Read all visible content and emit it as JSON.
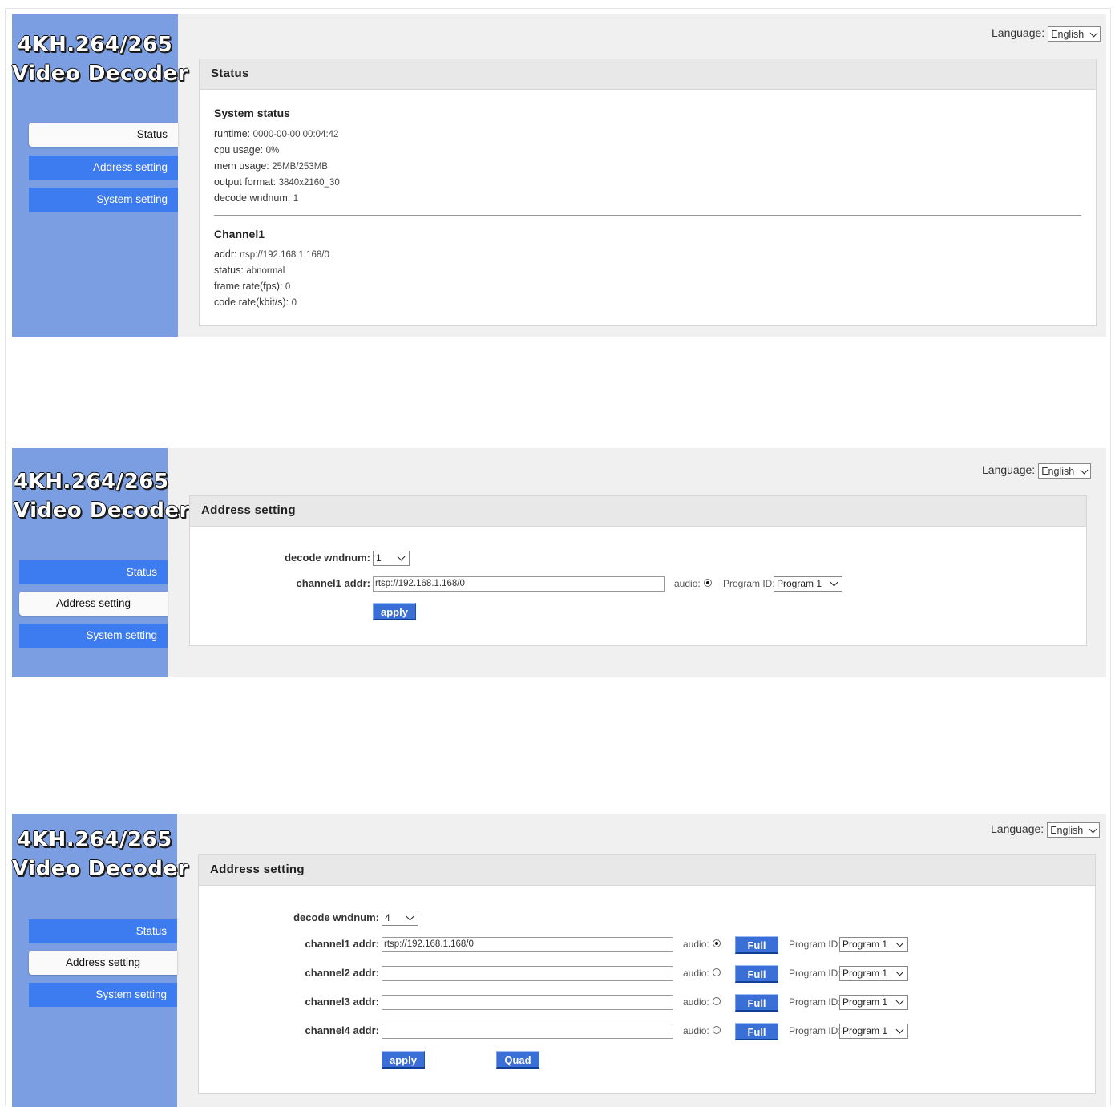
{
  "app": {
    "logo_line1": "4KH.264/265",
    "logo_line2": "Video Decoder"
  },
  "nav": {
    "status": "Status",
    "address": "Address setting",
    "system": "System setting"
  },
  "language": {
    "label": "Language:",
    "value": "English"
  },
  "colors": {
    "sidebar": "#7b9ee2",
    "nav_inactive": "#3d7bf0",
    "panel_bg": "#f0f0f0",
    "button": "#3a6fd8"
  },
  "panel1": {
    "card_title": "Status",
    "system_status": {
      "heading": "System status",
      "rows": [
        {
          "label": "runtime:",
          "value": "0000-00-00 00:04:42"
        },
        {
          "label": "cpu usage:",
          "value": "0%"
        },
        {
          "label": "mem usage:",
          "value": "25MB/253MB"
        },
        {
          "label": "output format:",
          "value": "3840x2160_30"
        },
        {
          "label": "decode wndnum:",
          "value": "1"
        }
      ]
    },
    "channel1": {
      "heading": "Channel1",
      "rows": [
        {
          "label": "addr:",
          "value": "rtsp://192.168.1.168/0"
        },
        {
          "label": "status:",
          "value": "abnormal"
        },
        {
          "label": "frame rate(fps):",
          "value": "0"
        },
        {
          "label": "code rate(kbit/s):",
          "value": "0"
        }
      ]
    }
  },
  "panel2": {
    "card_title": "Address setting",
    "decode_label": "decode wndnum:",
    "decode_value": "1",
    "channel1_label": "channel1 addr:",
    "channel1_value": "rtsp://192.168.1.168/0",
    "audio_label": "audio:",
    "program_label": "Program ID:",
    "program_value": "Program 1",
    "apply_label": "apply"
  },
  "panel3": {
    "card_title": "Address setting",
    "decode_label": "decode wndnum:",
    "decode_value": "4",
    "audio_label": "audio:",
    "program_label": "Program ID:",
    "full_label": "Full",
    "apply_label": "apply",
    "quad_label": "Quad",
    "channels": [
      {
        "label": "channel1 addr:",
        "value": "rtsp://192.168.1.168/0",
        "audio_selected": true,
        "program": "Program 1"
      },
      {
        "label": "channel2 addr:",
        "value": "",
        "audio_selected": false,
        "program": "Program 1"
      },
      {
        "label": "channel3 addr:",
        "value": "",
        "audio_selected": false,
        "program": "Program 1"
      },
      {
        "label": "channel4 addr:",
        "value": "",
        "audio_selected": false,
        "program": "Program 1"
      }
    ]
  }
}
